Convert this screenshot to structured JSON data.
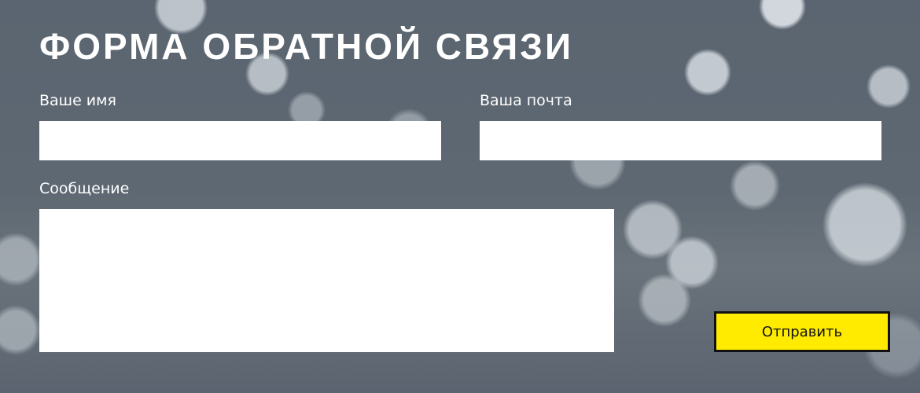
{
  "form": {
    "title": "ФОРМА ОБРАТНОЙ СВЯЗИ",
    "name_label": "Ваше имя",
    "email_label": "Ваша почта",
    "message_label": "Сообщение",
    "name_value": "",
    "email_value": "",
    "message_value": "",
    "submit_label": "Отправить",
    "colors": {
      "background": "#5d6770",
      "field": "#ffffff",
      "button": "#ffeb00",
      "button_border": "#111111",
      "text": "#ffffff"
    }
  }
}
